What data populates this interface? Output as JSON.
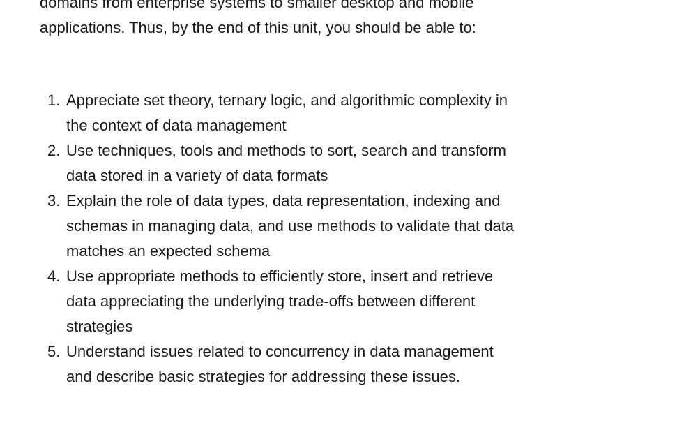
{
  "intro": {
    "line1": "domains from enterprise systems to smaller desktop and mobile",
    "line2": "applications. Thus, by the end of this unit, you should be able to:"
  },
  "objectives": [
    {
      "number": "1.",
      "lines": [
        "Appreciate set theory, ternary logic, and algorithmic complexity in",
        "the context of data management"
      ]
    },
    {
      "number": "2.",
      "lines": [
        "Use techniques, tools and methods to sort, search and transform",
        "data stored in a variety of data formats"
      ]
    },
    {
      "number": "3.",
      "lines": [
        "Explain the role of data types, data representation, indexing and",
        "schemas in managing data, and use methods to validate that data",
        "matches an expected schema"
      ]
    },
    {
      "number": "4.",
      "lines": [
        "Use appropriate methods to efficiently store, insert and retrieve",
        "data appreciating the underlying trade-offs between different",
        "strategies"
      ]
    },
    {
      "number": "5.",
      "lines": [
        "Understand issues related to concurrency in data management",
        "and describe basic strategies for addressing these issues."
      ]
    }
  ]
}
